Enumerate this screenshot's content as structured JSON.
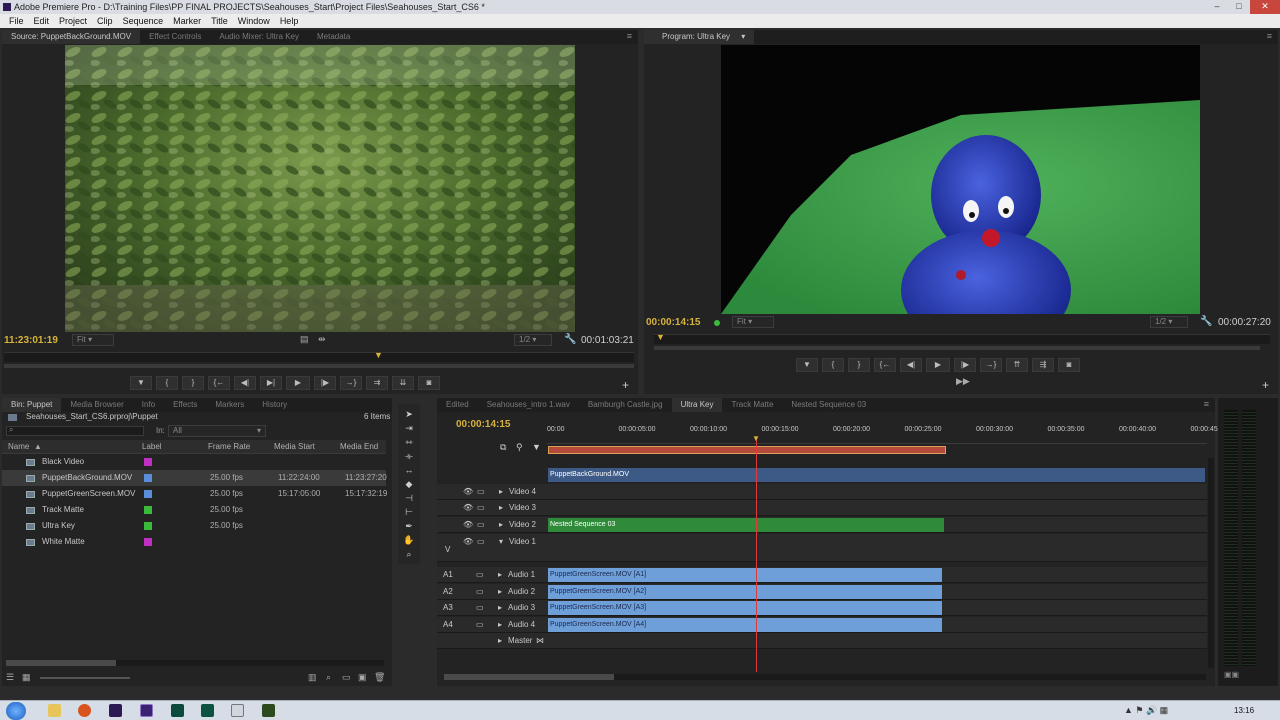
{
  "window": {
    "title": "Adobe Premiere Pro - D:\\Training Files\\PP FINAL PROJECTS\\Seahouses_Start\\Project Files\\Seahouses_Start_CS6 *"
  },
  "menu": [
    "File",
    "Edit",
    "Project",
    "Clip",
    "Sequence",
    "Marker",
    "Title",
    "Window",
    "Help"
  ],
  "source": {
    "tabs": [
      "Source: PuppetBackGround.MOV",
      "Effect Controls",
      "Audio Mixer: Ultra Key",
      "Metadata"
    ],
    "timecode": "11:23:01:19",
    "fit": "Fit",
    "resolution": "1/2",
    "duration": "00:01:03:21"
  },
  "program": {
    "tabs": [
      "Program: Ultra Key"
    ],
    "timecode": "00:00:14:15",
    "fit": "Fit",
    "resolution": "1/2",
    "duration": "00:00:27:20"
  },
  "controls": {
    "marker": "▼",
    "in": "{",
    "out": "}",
    "goto_in": "{←",
    "step_back": "◀|",
    "step_fwd": "|▶",
    "play": "▶",
    "goto_out": "→}",
    "insert": "⇉",
    "overwrite": "⇊",
    "export": "📷",
    "add": "+"
  },
  "bin": {
    "tabs": [
      "Bin: Puppet",
      "Media Browser",
      "Info",
      "Effects",
      "Markers",
      "History"
    ],
    "path": "Seahouses_Start_CS6.prproj\\Puppet",
    "count": "6 Items",
    "search_placeholder": "",
    "in_label": "In:",
    "in_value": "All",
    "columns": {
      "name": "Name",
      "label": "Label",
      "frame_rate": "Frame Rate",
      "media_start": "Media Start",
      "media_end": "Media End"
    },
    "items": [
      {
        "name": "Black Video",
        "color": "#c030c0",
        "frame_rate": "",
        "media_start": "",
        "media_end": ""
      },
      {
        "name": "PuppetBackGround.MOV",
        "color": "#5a8ed8",
        "frame_rate": "25.00 fps",
        "media_start": "11:22:24:00",
        "media_end": "11:23:27:20"
      },
      {
        "name": "PuppetGreenScreen.MOV",
        "color": "#5a8ed8",
        "frame_rate": "25.00 fps",
        "media_start": "15:17:05:00",
        "media_end": "15:17:32:19"
      },
      {
        "name": "Track Matte",
        "color": "#3cba3c",
        "frame_rate": "25.00 fps",
        "media_start": "",
        "media_end": ""
      },
      {
        "name": "Ultra Key",
        "color": "#3cba3c",
        "frame_rate": "25.00 fps",
        "media_start": "",
        "media_end": ""
      },
      {
        "name": "White Matte",
        "color": "#c030c0",
        "frame_rate": "",
        "media_start": "",
        "media_end": ""
      }
    ]
  },
  "timeline": {
    "tabs": [
      "Edited",
      "Seahouses_intro 1.wav",
      "Bamburgh Castle.jpg",
      "Ultra Key",
      "Track Matte",
      "Nested Sequence 03"
    ],
    "timecode": "00:00:14:15",
    "ruler": [
      "00:00",
      "00:00:05:00",
      "00:00:10:00",
      "00:00:15:00",
      "00:00:20:00",
      "00:00:25:00",
      "00:00:30:00",
      "00:00:35:00",
      "00:00:40:00",
      "00:00:45:00"
    ],
    "video_tracks": [
      "Video 4",
      "Video 3",
      "Video 2",
      "Video 1"
    ],
    "audio_tracks": [
      {
        "id": "A1",
        "name": "Audio 1"
      },
      {
        "id": "A2",
        "name": "Audio 2"
      },
      {
        "id": "A3",
        "name": "Audio 3"
      },
      {
        "id": "A4",
        "name": "Audio 4"
      }
    ],
    "master": "Master",
    "v_label": "V",
    "clips": {
      "top": "PuppetBackGround.MOV",
      "video2": "Nested Sequence 03",
      "a1": "PuppetGreenScreen.MOV [A1]",
      "a2": "PuppetGreenScreen.MOV [A2]",
      "a3": "PuppetGreenScreen.MOV [A3]",
      "a4": "PuppetGreenScreen.MOV [A4]"
    }
  },
  "taskbar": {
    "time": "13:16"
  }
}
